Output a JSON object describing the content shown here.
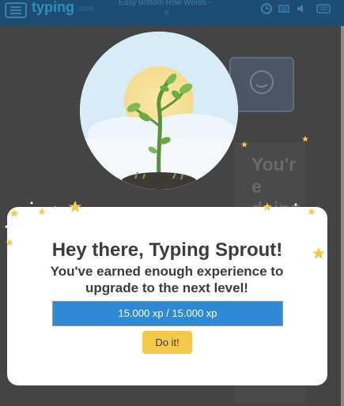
{
  "app": {
    "brand": "typing",
    "brand_suffix": ".com",
    "lesson_title": "Easy Bottom Row Words -",
    "lesson_sub": "II"
  },
  "background": {
    "partial_heading": "You're doing"
  },
  "modal": {
    "title": "Hey there, Typing Sprout!",
    "subtitle": "You've earned enough experience to upgrade to the next level!",
    "progress_text": "15.000 xp / 15.000 xp",
    "progress": 1.0,
    "button_label": "Do it!"
  },
  "colors": {
    "progress_fill": "#2f8ad6",
    "button": "#f5c84a",
    "star": "#f7c84a",
    "topbar": "#1e4d73",
    "sky": "#d8ecf7"
  },
  "icons": [
    "menu-icon",
    "clock-icon",
    "keyboard-icon",
    "speaker-icon",
    "settings-icon",
    "star-icon",
    "sprout-icon"
  ]
}
